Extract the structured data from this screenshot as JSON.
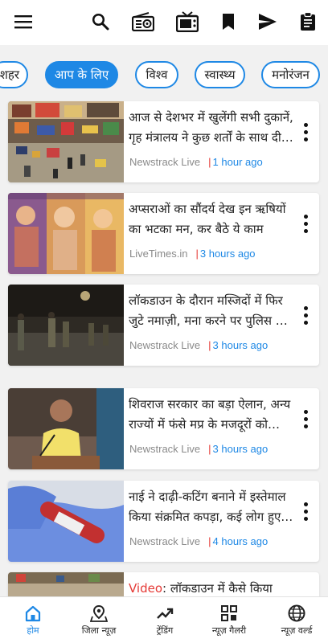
{
  "toolbar": {
    "icons": [
      "menu-icon",
      "search-icon",
      "radio-icon",
      "tv-icon",
      "bookmark-icon",
      "send-icon",
      "clipboard-icon"
    ]
  },
  "categories": {
    "items": [
      "शहर",
      "आप के लिए",
      "विश्व",
      "स्वास्थ्य",
      "मनोरंजन"
    ],
    "selected": "आप के लिए"
  },
  "colors": {
    "accent": "#1e88e5",
    "separator": "#e53935",
    "video_tag": "#e53935"
  },
  "news": [
    {
      "headline": "आज से देशभर में खुलेंगी सभी दुकानें, गृह मंत्रालय ने कुछ शर्तों के साथ दी अनुमति",
      "source": "Newstrack Live",
      "time": "1 hour ago"
    },
    {
      "headline": "अप्सराओं का सौंदर्य देख इन ऋषियों का भटका मन, कर बैठे ये काम",
      "source": "LiveTimes.in",
      "time": "3 hours ago"
    },
    {
      "headline": "लॉकडाउन के दौरान मस्जिदों में फिर जुटे नमाज़ी, मना करने पर पुलिस पर हमला",
      "source": "Newstrack Live",
      "time": "3 hours ago"
    },
    {
      "headline": "शिवराज सरकार का बड़ा ऐलान, अन्य राज्यों में फंसे मप्र के मजदूरों को मिलेगी राहत",
      "source": "Newstrack Live",
      "time": "3 hours ago"
    },
    {
      "headline": "नाई ने दाढ़ी-कटिंग बनाने में इस्तेमाल किया संक्रमित कपड़ा, कई लोग हुए संक्रमित",
      "source": "Newstrack Live",
      "time": "4 hours ago"
    },
    {
      "video_tag": "Video",
      "headline": ": लॉकडाउन में कैसे किया",
      "source": "",
      "time": ""
    }
  ],
  "bottom_nav": [
    {
      "label": "होम",
      "icon": "home-icon",
      "active": true
    },
    {
      "label": "जिला न्यूज़",
      "icon": "map-pin-icon",
      "active": false
    },
    {
      "label": "ट्रेंडिंग",
      "icon": "trending-icon",
      "active": false
    },
    {
      "label": "न्यूज़ गैलरी",
      "icon": "gallery-icon",
      "active": false
    },
    {
      "label": "न्यूज़ वर्ल्ड",
      "icon": "globe-icon",
      "active": false
    }
  ]
}
